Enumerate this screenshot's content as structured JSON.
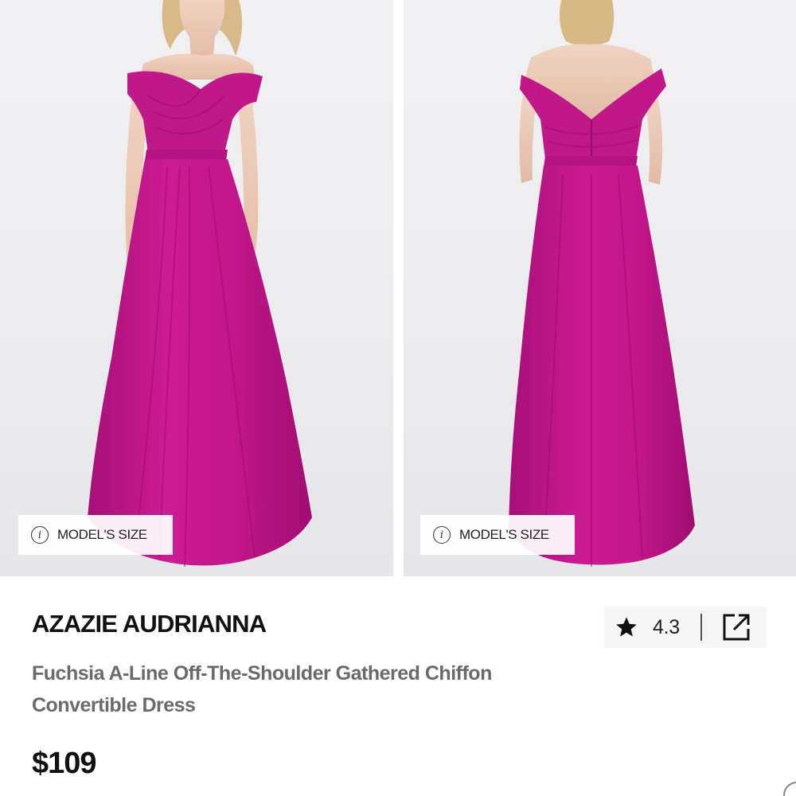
{
  "gallery": {
    "images": [
      {
        "view": "front",
        "model_size_label": "MODEL'S SIZE",
        "icon": "info-icon"
      },
      {
        "view": "back",
        "model_size_label": "MODEL'S SIZE",
        "icon": "info-icon"
      }
    ]
  },
  "product": {
    "brand": "AZAZIE AUDRIANNA",
    "description": "Fuchsia A-Line Off-The-Shoulder Gathered Chiffon Convertible Dress",
    "price": "$109",
    "rating": "4.3",
    "rating_icon": "star-icon",
    "share_icon": "share-icon"
  },
  "colors": {
    "dress": "#c2188b",
    "text_primary": "#111111",
    "text_secondary": "#6a6a6a",
    "rating_background": "#f6f6f6"
  }
}
